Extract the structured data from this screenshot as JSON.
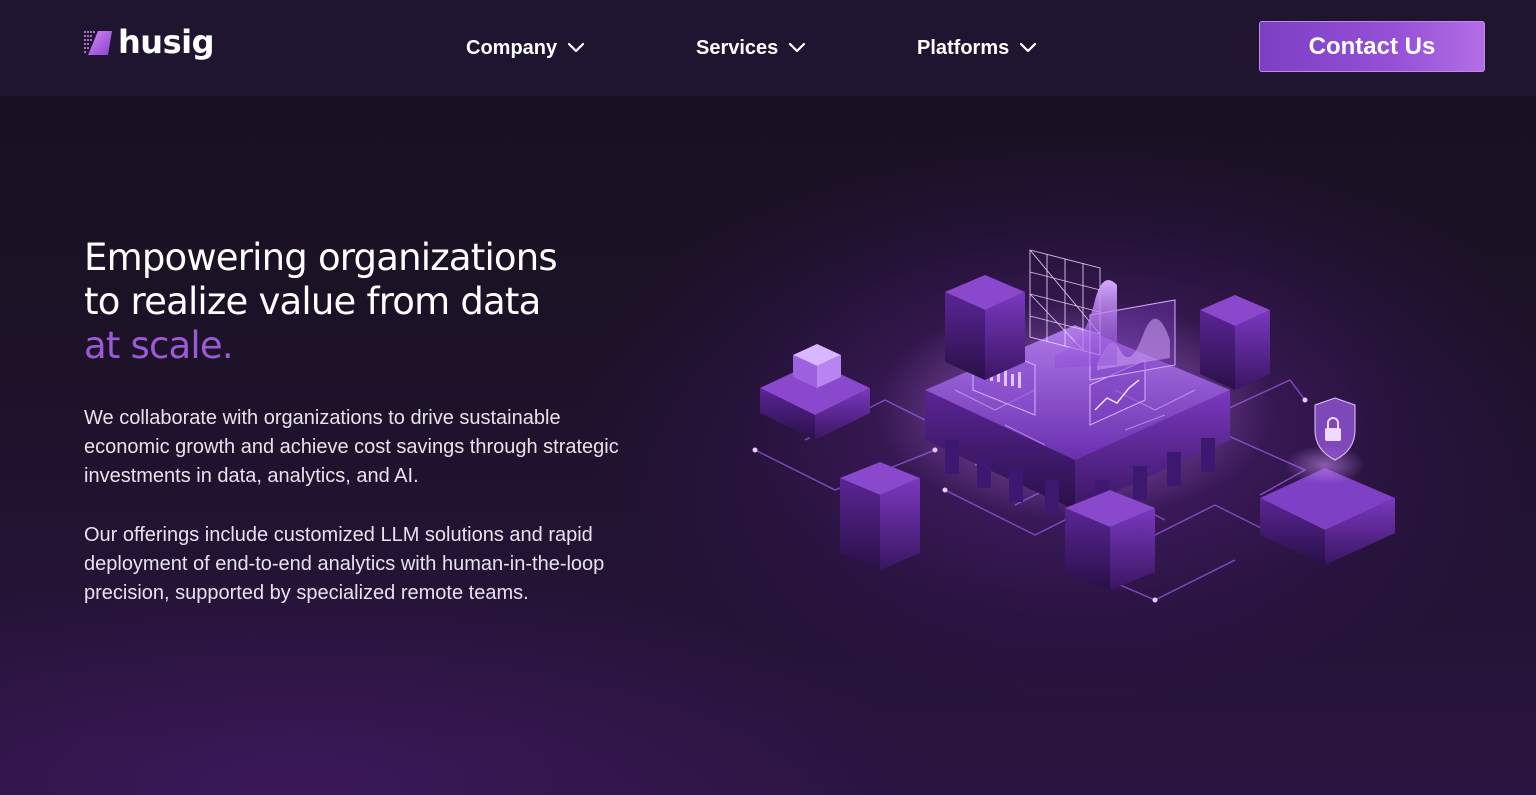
{
  "header": {
    "logo_text": "husig",
    "nav": [
      {
        "label": "Company"
      },
      {
        "label": "Services"
      },
      {
        "label": "Platforms"
      }
    ],
    "cta_label": "Contact Us"
  },
  "hero": {
    "title_line1": "Empowering organizations",
    "title_line2": "to realize value from data",
    "title_accent": "at scale.",
    "paragraph1": [
      "We collaborate with organizations to drive sustainable",
      "economic growth and achieve cost savings through strategic",
      "investments in data, analytics, and AI."
    ],
    "paragraph2": [
      "Our offerings include customized LLM solutions and rapid",
      "deployment of end-to-end analytics with human-in-the-loop",
      "precision, supported by specialized remote teams."
    ]
  },
  "colors": {
    "background": "#1a1024",
    "header": "#1f1530",
    "accent": "#9b5ad6",
    "button": "#8a47cf"
  },
  "icons": {
    "logo": "husig-logo-mark",
    "nav_chevron": "chevron-down-icon",
    "illustration": "isometric-data-platform-illustration"
  }
}
